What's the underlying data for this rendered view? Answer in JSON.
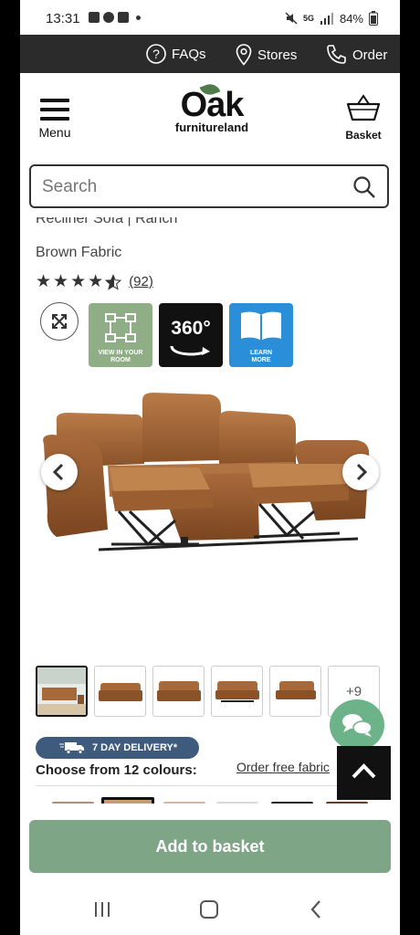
{
  "status": {
    "time": "13:31",
    "network": "5G",
    "battery": "84%"
  },
  "topbar": {
    "faqs": "FAQs",
    "stores": "Stores",
    "order": "Order"
  },
  "header": {
    "menu_label": "Menu",
    "logo_main": "Oak",
    "logo_sub": "furnitureland",
    "basket_label": "Basket"
  },
  "search": {
    "placeholder": "Search"
  },
  "product": {
    "title_line1": "Recliner Sofa | Ranch",
    "title_line2": "Brown Fabric",
    "rating_stars": 4.5,
    "review_count": "(92)"
  },
  "media_tiles": {
    "view_in_room": "VIEW IN YOUR ROOM",
    "three_sixty": "360°",
    "learn_more": "LEARN MORE"
  },
  "gallery": {
    "more_label": "+9"
  },
  "delivery_badge": "7 DAY DELIVERY*",
  "colours": {
    "heading": "Choose from 12 colours:",
    "order_fabric": "Order free fabric"
  },
  "cta": {
    "add_to_basket": "Add to basket"
  },
  "colors": {
    "brand_green": "#7ea586",
    "chat_green": "#6db38a",
    "delivery_blue": "#3e5b7d",
    "topbar_dark": "#2b2b2b",
    "sofa_brown": "#a8693a"
  }
}
